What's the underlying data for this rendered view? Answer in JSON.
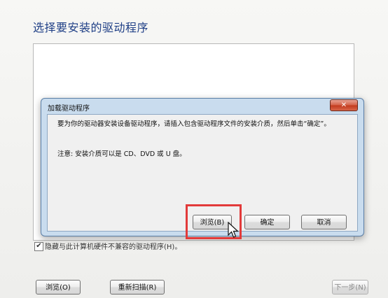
{
  "page": {
    "title": "选择要安装的驱动程序",
    "hide_incompatible": "隐藏与此计算机硬件不兼容的驱动程序(H)。",
    "hide_incompatible_checked": true
  },
  "buttons": {
    "browse": "浏览(O)",
    "rescan": "重新扫描(R)",
    "next": "下一步(N)"
  },
  "dialog": {
    "title": "加载驱动程序",
    "close": "✕",
    "message": "要为你的驱动器安装设备驱动程序，请插入包含驱动程序文件的安装介质，然后单击“确定”。",
    "note": "注意: 安装介质可以是 CD、DVD 或 U 盘。",
    "browse_label": "浏览(B)",
    "ok_label": "确定",
    "cancel_label": "取消"
  },
  "colors": {
    "title_blue": "#1f3f86",
    "highlight_red": "#e23a3a",
    "dialog_frame": "#c9dcee"
  }
}
